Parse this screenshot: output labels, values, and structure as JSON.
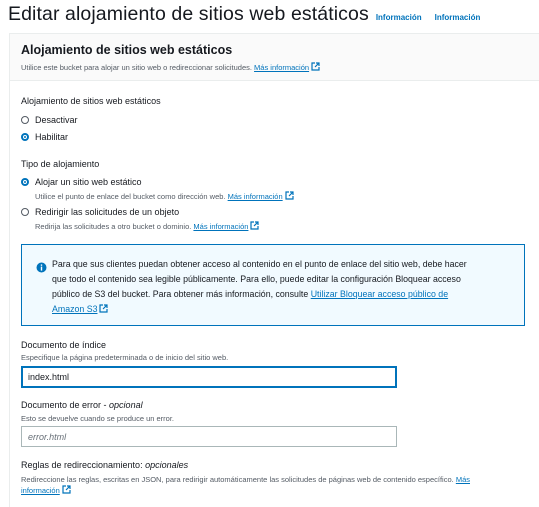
{
  "header": {
    "title": "Editar alojamiento de sitios web estáticos",
    "info_link_1": "Información",
    "info_link_2": "Información"
  },
  "panel": {
    "title": "Alojamiento de sitios web estáticos",
    "description": "Utilice este bucket para alojar un sitio web o redireccionar solicitudes.",
    "more_info": "Más información"
  },
  "hosting": {
    "label": "Alojamiento de sitios web estáticos",
    "options": [
      {
        "label": "Desactivar",
        "selected": false
      },
      {
        "label": "Habilitar",
        "selected": true
      }
    ]
  },
  "hosting_type": {
    "label": "Tipo de alojamiento",
    "options": [
      {
        "label": "Alojar un sitio web estático",
        "description": "Utilice el punto de enlace del bucket como dirección web.",
        "more_info": "Más información",
        "selected": true
      },
      {
        "label": "Redirigir las solicitudes de un objeto",
        "description": "Redirija las solicitudes a otro bucket o dominio.",
        "more_info": "Más información",
        "selected": false
      }
    ]
  },
  "alert": {
    "line1": "Para que sus clientes puedan obtener acceso al contenido en el punto de enlace del sitio web, debe hacer",
    "line2": "que todo el contenido sea legible públicamente. Para ello, puede editar la configuración Bloquear acceso",
    "line3_text": "público de S3 del bucket. Para obtener más información, consulte ",
    "link_part1": "Utilizar Bloquear acceso público de",
    "link_part2": "Amazon S3"
  },
  "index_document": {
    "label": "Documento de índice",
    "description": "Especifique la página predeterminada o de inicio del sitio web.",
    "value": "index.html"
  },
  "error_document": {
    "label": "Documento de error",
    "optional": "opcional",
    "description": "Esto se devuelve cuando se produce un error.",
    "placeholder": "error.html"
  },
  "redirect_rules": {
    "label": "Reglas de redireccionamiento:",
    "optional": "opcionales",
    "description": "Redireccione las reglas, escritas en JSON, para redirigir automáticamente las solicitudes de páginas web de contenido específico.",
    "more_info_1": "Más",
    "more_info_2": "información"
  },
  "colors": {
    "link": "#0073bb",
    "alert_bg": "#f1faff",
    "text": "#16191f",
    "secondary_text": "#545b64"
  }
}
